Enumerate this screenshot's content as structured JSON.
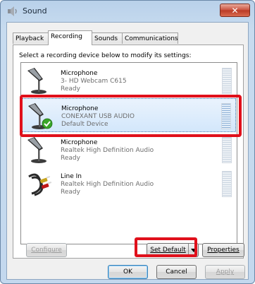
{
  "window": {
    "title": "Sound",
    "close_label": "✕"
  },
  "tabs": [
    {
      "label": "Playback",
      "active": false
    },
    {
      "label": "Recording",
      "active": true
    },
    {
      "label": "Sounds",
      "active": false
    },
    {
      "label": "Communications",
      "active": false
    }
  ],
  "instruction": "Select a recording device below to modify its settings:",
  "devices": [
    {
      "name": "Microphone",
      "description": "3- HD Webcam C615",
      "status": "Ready",
      "icon": "microphone-icon",
      "selected": false
    },
    {
      "name": "Microphone",
      "description": "CONEXANT USB AUDIO",
      "status": "Default Device",
      "icon": "microphone-default-icon",
      "selected": true
    },
    {
      "name": "Microphone",
      "description": "Realtek High Definition Audio",
      "status": "Ready",
      "icon": "microphone-icon",
      "selected": false
    },
    {
      "name": "Line In",
      "description": "Realtek High Definition Audio",
      "status": "Ready",
      "icon": "line-in-cable-icon",
      "selected": false
    }
  ],
  "buttons": {
    "configure": "Configure",
    "set_default": "Set Default",
    "properties": "Properties",
    "ok": "OK",
    "cancel": "Cancel",
    "apply": "Apply"
  },
  "colors": {
    "highlight": "#e0101b",
    "selection": "#d3e7fb",
    "default_check": "#3aa629"
  }
}
